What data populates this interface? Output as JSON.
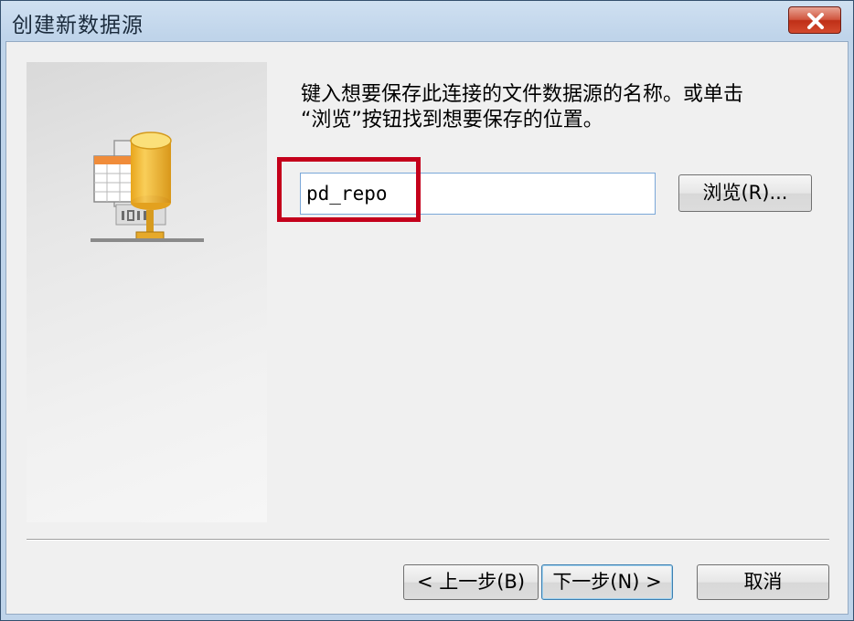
{
  "window": {
    "title": "创建新数据源"
  },
  "instruction": "键入想要保存此连接的文件数据源的名称。或单击\n“浏览”按钮找到想要保存的位置。",
  "name_input": {
    "value": "pd_repo"
  },
  "buttons": {
    "browse": "浏览(R)...",
    "back": "< 上一步(B)",
    "next": "下一步(N) >",
    "cancel": "取消"
  },
  "icons": {
    "close": "close-icon",
    "datasource": "file-datasource-icon"
  },
  "colors": {
    "highlight": "#c4001b",
    "close_button": "#c8391f",
    "database_gold": "#f0b428"
  }
}
